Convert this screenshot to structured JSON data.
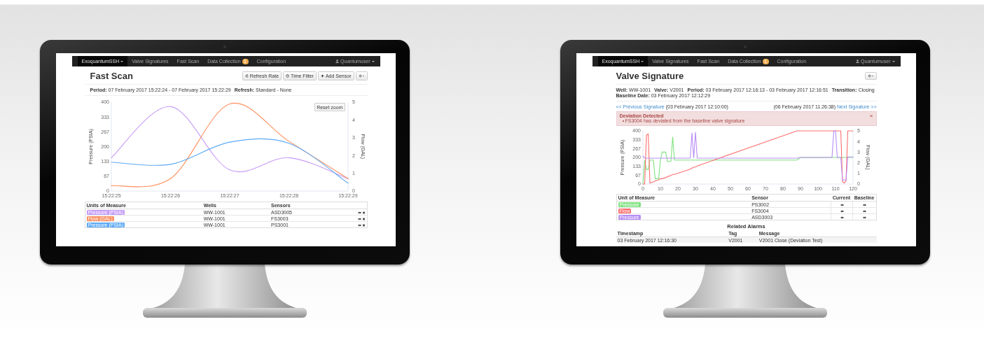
{
  "monitors": [
    {
      "kind": "fast_scan",
      "navbar": {
        "brand": "ExoquantumSSH",
        "items": [
          {
            "label": "Valve Signatures"
          },
          {
            "label": "Fast Scan"
          },
          {
            "label": "Data Collection",
            "badge": "1"
          },
          {
            "label": "Configuration"
          }
        ],
        "user": "Quantumuser"
      },
      "title": "Fast Scan",
      "actions": [
        {
          "kind": "button",
          "label": "Refresh Rate"
        },
        {
          "kind": "button",
          "label": "Time Filter"
        },
        {
          "kind": "button",
          "label": "Add Sensor"
        },
        {
          "kind": "dropdown"
        }
      ],
      "details": [
        {
          "label": "Period:",
          "value": "07 February 2017 15:22:24 - 07 February 2017 15:22:29"
        },
        {
          "label": "Refresh:",
          "value": "Standard - None"
        }
      ],
      "chart": {
        "reset_zoom": "Reset zoom",
        "chart_data": {
          "type": "line",
          "ylabel": "Pressure (PSIA)",
          "y2label": "Flow (GAL)",
          "categories": [
            "15:22:25",
            "15:22:26",
            "15:22:27",
            "15:22:28",
            "15:22:29"
          ],
          "ylim": [
            0,
            400
          ],
          "yticks": [
            0,
            67,
            133,
            200,
            267,
            333,
            400
          ],
          "y2lim": [
            0,
            5
          ],
          "y2ticks": [
            0,
            1,
            2,
            3,
            4,
            5
          ],
          "series": [
            {
              "color": "#c69cf7",
              "values": [
                150,
                380,
                95,
                150,
                55
              ]
            },
            {
              "color": "#ff8f5e",
              "axis": "y2",
              "values": [
                0.3,
                0.7,
                4.9,
                2.8,
                0.7
              ]
            },
            {
              "color": "#5eaaf5",
              "values": [
                130,
                120,
                220,
                215,
                35
              ]
            }
          ]
        }
      },
      "sensors_table": {
        "columns": [
          "Units of Measure",
          "Wells",
          "Sensors"
        ],
        "rows": [
          {
            "color": "#c69cf7",
            "cells": [
              "Pressure (PSIA)",
              "WW-1001",
              "ASD3005"
            ]
          },
          {
            "color": "#ff8f5e",
            "cells": [
              "Flow (GAL)",
              "WW-1001",
              "FS3003"
            ]
          },
          {
            "color": "#5eaaf5",
            "cells": [
              "Pressure (PSIA)",
              "WW-1001",
              "PS3001"
            ]
          }
        ]
      }
    },
    {
      "kind": "valve_signature",
      "navbar": {
        "brand": "ExoquantumSSH",
        "items": [
          {
            "label": "Valve Signatures"
          },
          {
            "label": "Fast Scan"
          },
          {
            "label": "Data Collection",
            "badge": "1"
          },
          {
            "label": "Configuration"
          }
        ],
        "user": "Quantumuser"
      },
      "title": "Valve Signature",
      "actions": [
        {
          "kind": "dropdown"
        }
      ],
      "details": [
        {
          "label": "Well:",
          "value": "WW-1001"
        },
        {
          "label": "Valve:",
          "value": "V2001"
        },
        {
          "label": "Period:",
          "value": "03 February 2017 12:16:13 - 03 February 2017 12:16:51"
        },
        {
          "label": "Transition:",
          "value": "Closing"
        },
        {
          "label": "Baseline Date:",
          "value": "03 February 2017 12:12:29"
        }
      ],
      "signature_nav": {
        "previous_link": "<< Previous Signature",
        "previous_date": "(03 February 2017 12:10:00)",
        "next_date": "(06 February 2017 11:26:38)",
        "next_link": "Next Signature >>"
      },
      "alert": {
        "title": "Deviation Detected",
        "items": [
          "FS3004 has deviated from the baseline valve signature"
        ],
        "close": "×"
      },
      "chart": {
        "chart_data": {
          "type": "line",
          "ylabel": "Pressure (PSIA)",
          "y2label": "Flow (GAL)",
          "x": [
            0,
            1,
            2,
            3,
            4,
            6,
            7,
            9,
            10,
            11,
            13,
            14,
            16,
            17,
            18,
            27,
            28,
            29,
            30,
            31,
            88,
            90,
            108,
            109,
            110,
            111,
            113,
            114,
            115,
            116,
            117,
            118,
            119,
            120
          ],
          "xlim": [
            0,
            120
          ],
          "xticks": [
            0,
            10,
            20,
            30,
            40,
            50,
            60,
            70,
            80,
            90,
            100,
            110,
            120
          ],
          "ylim": [
            0,
            400
          ],
          "yticks": [
            0,
            67,
            133,
            200,
            267,
            333,
            400
          ],
          "y2lim": [
            0,
            5
          ],
          "y2ticks": [
            0,
            1,
            2,
            3,
            4,
            5
          ],
          "series": [
            {
              "color": "#7fe27f",
              "values": [
                0,
                180,
                110,
                110,
                180,
                180,
                40,
                40,
                180,
                240,
                240,
                170,
                170,
                355,
                180,
                180,
                180,
                180,
                180,
                180,
                180,
                200,
                200,
                200,
                200,
                200,
                200,
                200,
                200,
                200,
                200,
                200,
                200,
                200
              ]
            },
            {
              "color": "#ff6f6f",
              "axis": "y2",
              "values": [
                0,
                0,
                4.6,
                4.7,
                0.1,
                0.2,
                0.3,
                0.4,
                0.5,
                0.5,
                0.6,
                0.7,
                0.8,
                0.9,
                0.9,
                1.4,
                1.5,
                1.6,
                1.6,
                1.7,
                5,
                5,
                5,
                5,
                5,
                5,
                5,
                0.2,
                0.1,
                0.3,
                5,
                5,
                5,
                5
              ]
            },
            {
              "color": "#b88ef5",
              "values": [
                210,
                195,
                195,
                195,
                195,
                195,
                195,
                195,
                195,
                195,
                195,
                195,
                195,
                195,
                195,
                195,
                385,
                195,
                390,
                195,
                195,
                200,
                200,
                400,
                400,
                200,
                200,
                30,
                30,
                30,
                204,
                204,
                204,
                204
              ]
            }
          ]
        }
      },
      "sensors_table": {
        "columns": [
          "Unit of Measure",
          "Sensor",
          "Current",
          "Baseline"
        ],
        "rows": [
          {
            "color": "#7fe27f",
            "cells": [
              "Pressure",
              "PS3002"
            ]
          },
          {
            "color": "#ff6f6f",
            "cells": [
              "Flow",
              "FS3004"
            ]
          },
          {
            "color": "#b88ef5",
            "cells": [
              "Pressure",
              "ASD3003"
            ]
          }
        ]
      },
      "alarms": {
        "title": "Related Alarms",
        "columns": [
          "Timestamp",
          "Tag",
          "Message"
        ],
        "rows": [
          [
            "03 February 2017 12:16:30",
            "V2001",
            "V2001 Close (Deviation Test)"
          ]
        ]
      }
    }
  ]
}
